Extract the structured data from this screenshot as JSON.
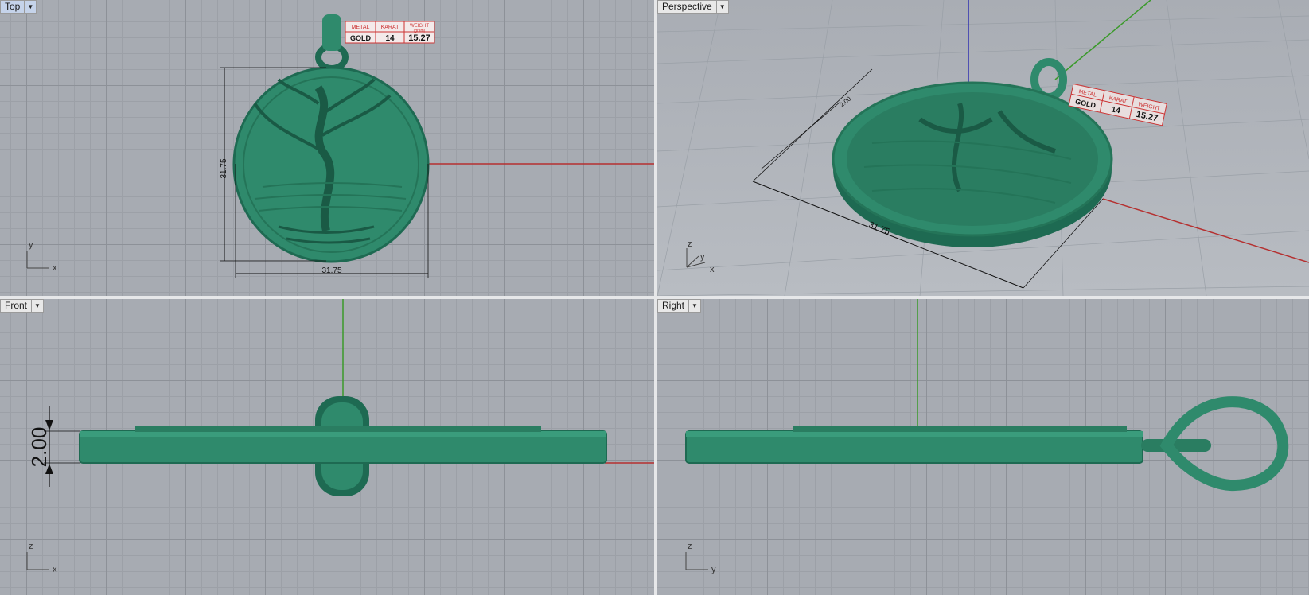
{
  "viewports": {
    "top": {
      "label": "Top",
      "active": true
    },
    "perspective": {
      "label": "Perspective"
    },
    "front": {
      "label": "Front"
    },
    "right": {
      "label": "Right"
    }
  },
  "dimensions": {
    "top_width": "31.75",
    "top_height": "31.75",
    "persp_width": "31.75",
    "persp_small": "2.00",
    "front_thickness": "2.00"
  },
  "info_table": {
    "headers": [
      "METAL",
      "KARAT",
      "WEIGHT"
    ],
    "subheader": "(gram)",
    "values": [
      "GOLD",
      "14",
      "15.27"
    ]
  },
  "axes": {
    "top": [
      "y",
      "x"
    ],
    "perspective": [
      "z",
      "y",
      "x"
    ],
    "front": [
      "z",
      "x"
    ],
    "right": [
      "z",
      "y"
    ]
  },
  "colors": {
    "model": "#2f8a6c",
    "model_dark": "#1e6a52",
    "grid": "#a7abb2",
    "x_axis": "#b53030",
    "y_axis": "#3a9a2a",
    "z_axis": "#3030b0"
  }
}
